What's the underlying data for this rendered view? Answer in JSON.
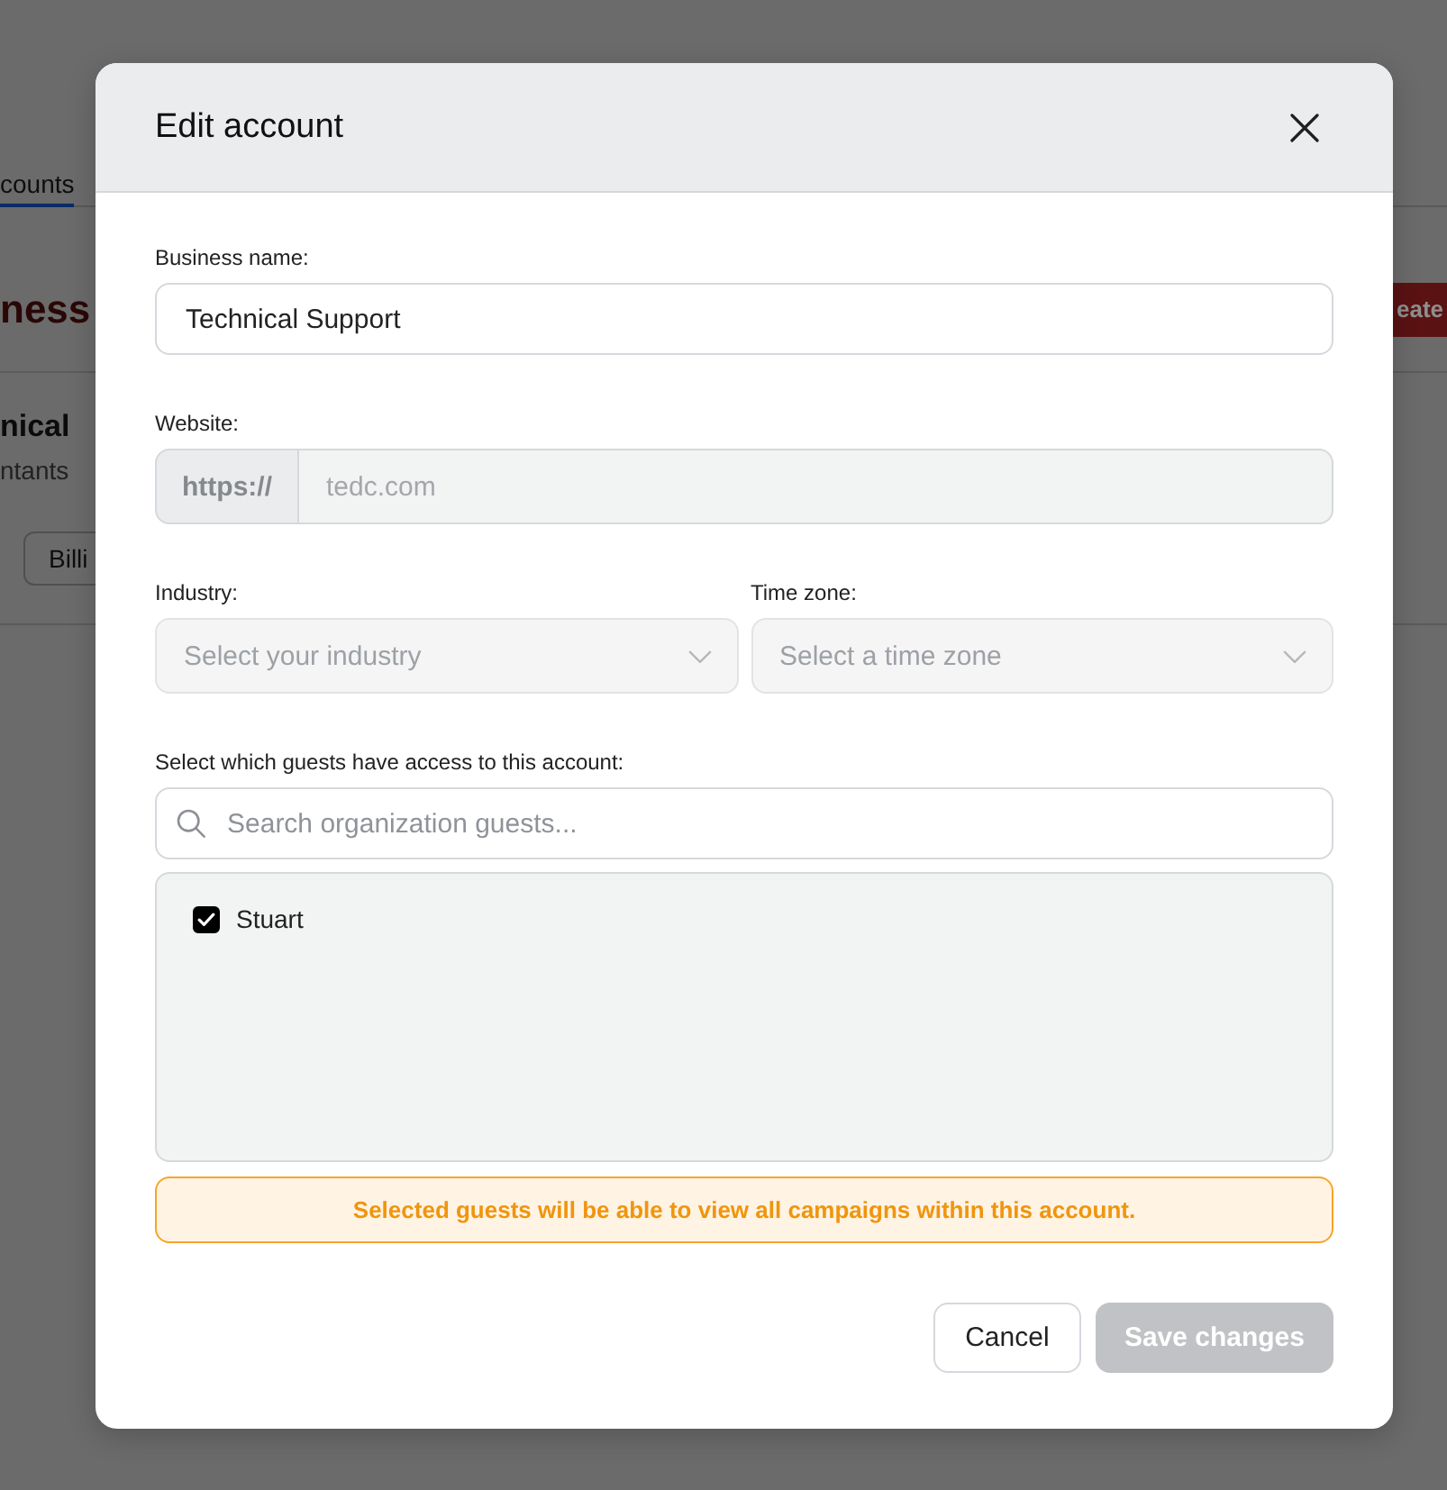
{
  "background_page": {
    "tabs": [
      {
        "label": "counts",
        "selected": true
      }
    ],
    "heading": "ness",
    "create_button": "eate",
    "account": {
      "name": "nical",
      "subtitle": "ntants"
    },
    "buttons": [
      "Billi"
    ]
  },
  "dialog": {
    "title": "Edit account",
    "fields": [
      {
        "kind": "text",
        "label": "Business name:",
        "value": "Technical Support",
        "disabled": false
      },
      {
        "kind": "url",
        "label": "Website:",
        "prefix": "https://",
        "value": "tedc.com",
        "disabled": true
      }
    ],
    "selects": [
      {
        "label": "Industry:",
        "placeholder": "Select your industry",
        "disabled": true
      },
      {
        "label": "Time zone:",
        "placeholder": "Select a time zone",
        "disabled": true
      }
    ],
    "guests": {
      "label": "Select which guests have access to this account:",
      "search": {
        "placeholder": "Search organization guests..."
      },
      "items": [
        {
          "name": "Stuart",
          "checked": true
        }
      ]
    },
    "notice": "Selected guests will be able to view all campaigns within this account.",
    "buttons": [
      {
        "label": "Cancel",
        "kind": "secondary",
        "disabled": false
      },
      {
        "label": "Save changes",
        "kind": "primary",
        "disabled": true
      }
    ]
  }
}
